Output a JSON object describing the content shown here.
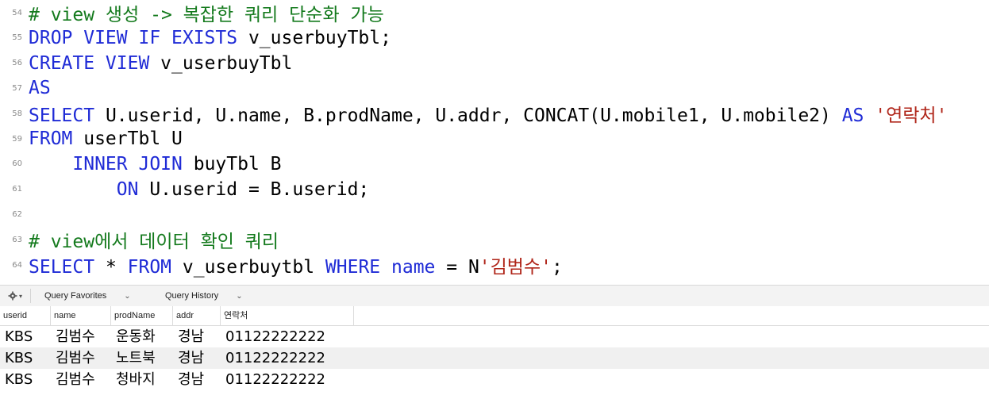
{
  "editor": {
    "lines": [
      {
        "num": "54",
        "tokens": [
          {
            "t": "# view 생성 -> 복잡한 쿼리 단순화 가능",
            "c": "cm"
          }
        ]
      },
      {
        "num": "55",
        "tokens": [
          {
            "t": "DROP VIEW IF EXISTS",
            "c": "kw"
          },
          {
            "t": " v_userbuyTbl;",
            "c": "plain"
          }
        ]
      },
      {
        "num": "56",
        "tokens": [
          {
            "t": "CREATE VIEW",
            "c": "kw"
          },
          {
            "t": " v_userbuyTbl",
            "c": "plain"
          }
        ]
      },
      {
        "num": "57",
        "tokens": [
          {
            "t": "AS",
            "c": "kw"
          }
        ]
      },
      {
        "num": "58",
        "tokens": [
          {
            "t": "SELECT",
            "c": "kw"
          },
          {
            "t": " U.userid, U.name, B.prodName, U.addr, CONCAT(U.mobile1, U.mobile2) ",
            "c": "plain"
          },
          {
            "t": "AS",
            "c": "kw"
          },
          {
            "t": " ",
            "c": "plain"
          },
          {
            "t": "'연락처'",
            "c": "str"
          }
        ]
      },
      {
        "num": "59",
        "tokens": [
          {
            "t": "FROM",
            "c": "kw"
          },
          {
            "t": " userTbl U",
            "c": "plain"
          }
        ]
      },
      {
        "num": "60",
        "tokens": [
          {
            "t": "    INNER JOIN",
            "c": "kw"
          },
          {
            "t": " buyTbl B",
            "c": "plain"
          }
        ]
      },
      {
        "num": "61",
        "tokens": [
          {
            "t": "        ON",
            "c": "kw"
          },
          {
            "t": " U.userid = B.userid;",
            "c": "plain"
          }
        ]
      },
      {
        "num": "62",
        "tokens": []
      },
      {
        "num": "63",
        "tokens": [
          {
            "t": "# view에서 데이터 확인 쿼리",
            "c": "cm"
          }
        ]
      },
      {
        "num": "64",
        "tokens": [
          {
            "t": "SELECT",
            "c": "kw"
          },
          {
            "t": " * ",
            "c": "plain"
          },
          {
            "t": "FROM",
            "c": "kw"
          },
          {
            "t": " v_userbuytbl ",
            "c": "plain"
          },
          {
            "t": "WHERE",
            "c": "kw"
          },
          {
            "t": " ",
            "c": "plain"
          },
          {
            "t": "name",
            "c": "kw"
          },
          {
            "t": " = N",
            "c": "plain"
          },
          {
            "t": "'김범수'",
            "c": "str"
          },
          {
            "t": ";",
            "c": "plain"
          }
        ]
      }
    ]
  },
  "toolbar": {
    "gear_icon": "gear-icon",
    "favorites_label": "Query Favorites",
    "history_label": "Query History",
    "chevron": "⌄"
  },
  "results": {
    "columns": [
      "userid",
      "name",
      "prodName",
      "addr",
      "연락처"
    ],
    "rows": [
      [
        "KBS",
        "김범수",
        "운동화",
        "경남",
        "01122222222"
      ],
      [
        "KBS",
        "김범수",
        "노트북",
        "경남",
        "01122222222"
      ],
      [
        "KBS",
        "김범수",
        "청바지",
        "경남",
        "01122222222"
      ]
    ]
  }
}
